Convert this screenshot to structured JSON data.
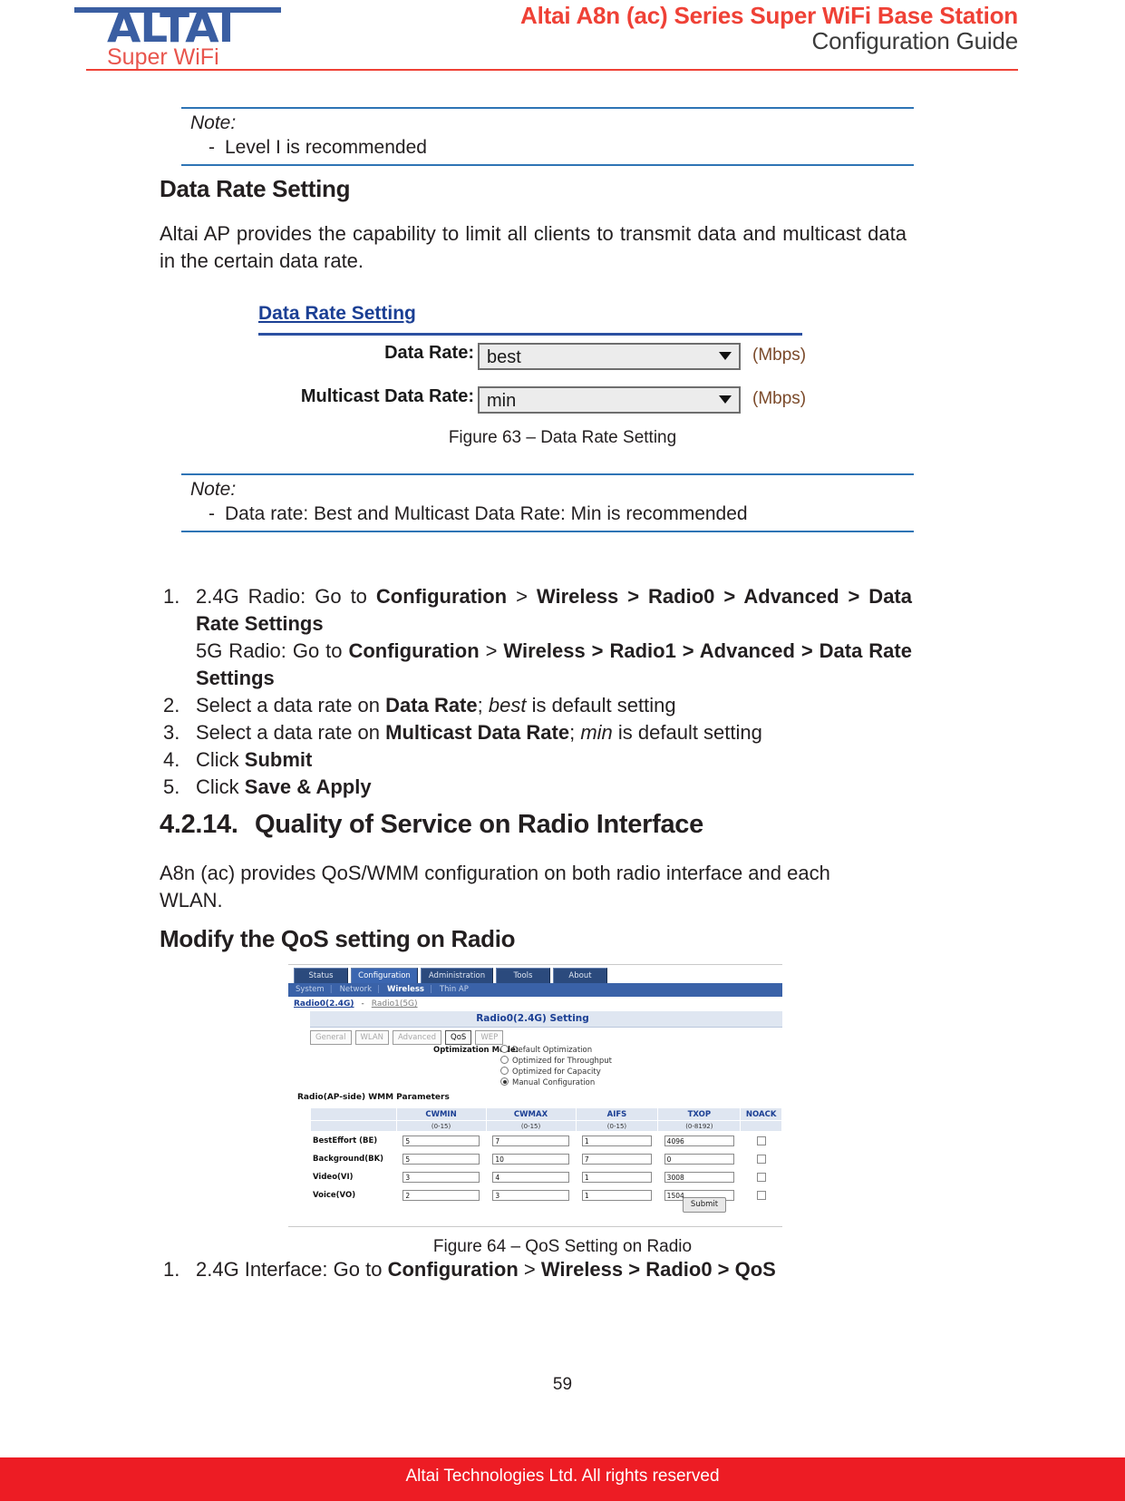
{
  "header": {
    "logo_main": "ALTAI",
    "logo_sub": "Super WiFi",
    "title_line1": "Altai A8n (ac) Series Super WiFi Base Station",
    "title_line2": "Configuration Guide",
    "brand_red": "#ef4136",
    "brand_blue": "#3a5ea2"
  },
  "note1": {
    "title": "Note:",
    "dash": "-",
    "item": "Level I is recommended"
  },
  "heading_data_rate": "Data Rate Setting",
  "para_data_rate": "Altai AP provides the capability to limit all clients to transmit data and multicast data in the certain data rate.",
  "figure63": {
    "panel_title": "Data Rate Setting",
    "rows": [
      {
        "label": "Data Rate:",
        "value": "best",
        "unit": "(Mbps)"
      },
      {
        "label": "Multicast Data Rate:",
        "value": "min",
        "unit": "(Mbps)"
      }
    ],
    "caption": "Figure 63 – Data Rate Setting"
  },
  "note2": {
    "title": "Note:",
    "dash": "-",
    "item": "Data rate: Best and Multicast Data Rate: Min is recommended"
  },
  "steps_data_rate": [
    {
      "n": "1.",
      "lines": [
        {
          "segments": [
            {
              "t": "2.4G Radio: Go to ",
              "style": "normal"
            },
            {
              "t": "Configuration",
              "style": "bold"
            },
            {
              "t": " > ",
              "style": "normal"
            },
            {
              "t": "Wireless > Radio0 > Advanced > Data Rate Settings",
              "style": "bold"
            }
          ]
        },
        {
          "segments": [
            {
              "t": "5G Radio: Go to ",
              "style": "normal"
            },
            {
              "t": "Configuration",
              "style": "bold"
            },
            {
              "t": " > ",
              "style": "normal"
            },
            {
              "t": "Wireless > Radio1 > Advanced > Data Rate Settings",
              "style": "bold"
            }
          ]
        }
      ]
    },
    {
      "n": "2.",
      "lines": [
        {
          "segments": [
            {
              "t": "Select a data rate on ",
              "style": "normal"
            },
            {
              "t": "Data Rate",
              "style": "bold"
            },
            {
              "t": "; ",
              "style": "normal"
            },
            {
              "t": "best",
              "style": "italic"
            },
            {
              "t": " is default setting",
              "style": "normal"
            }
          ]
        }
      ]
    },
    {
      "n": "3.",
      "lines": [
        {
          "segments": [
            {
              "t": "Select a data rate on ",
              "style": "normal"
            },
            {
              "t": "Multicast Data Rate",
              "style": "bold"
            },
            {
              "t": "; ",
              "style": "normal"
            },
            {
              "t": "min",
              "style": "italic"
            },
            {
              "t": " is default setting",
              "style": "normal"
            }
          ]
        }
      ]
    },
    {
      "n": "4.",
      "lines": [
        {
          "segments": [
            {
              "t": "Click ",
              "style": "normal"
            },
            {
              "t": "Submit",
              "style": "bold"
            }
          ]
        }
      ]
    },
    {
      "n": "5.",
      "lines": [
        {
          "segments": [
            {
              "t": "Click ",
              "style": "normal"
            },
            {
              "t": "Save & Apply",
              "style": "bold"
            }
          ]
        }
      ]
    }
  ],
  "section": {
    "number": "4.2.14.",
    "title": "Quality of Service on Radio Interface",
    "para": "A8n (ac) provides QoS/WMM configuration on both radio interface and each WLAN.",
    "sub_heading": "Modify the QoS setting on Radio"
  },
  "figure64": {
    "caption": "Figure 64 – QoS Setting on Radio",
    "nav_tabs": [
      {
        "label": "Status",
        "active": false
      },
      {
        "label": "Configuration",
        "active": true
      },
      {
        "label": "Administration",
        "active": false
      },
      {
        "label": "Tools",
        "active": false
      },
      {
        "label": "About",
        "active": false
      }
    ],
    "sub_nav": [
      {
        "label": "System",
        "active": false
      },
      {
        "label": "Network",
        "active": false
      },
      {
        "label": "Wireless",
        "active": true
      },
      {
        "label": "Thin AP",
        "active": false
      }
    ],
    "radio_links": [
      {
        "label": "Radio0(2.4G)",
        "active": true
      },
      {
        "label": "Radio1(5G)",
        "active": false
      }
    ],
    "radio_link_separator": "-",
    "setting_bar_title": "Radio0(2.4G) Setting",
    "sub_tabs": [
      {
        "label": "General",
        "selected": false
      },
      {
        "label": "WLAN",
        "selected": false
      },
      {
        "label": "Advanced",
        "selected": false
      },
      {
        "label": "QoS",
        "selected": true
      },
      {
        "label": "WEP",
        "selected": false
      }
    ],
    "optimization_label": "Optimization Mode:",
    "optimization_options": [
      {
        "label": "Default Optimization",
        "checked": false
      },
      {
        "label": "Optimized for Throughput",
        "checked": false
      },
      {
        "label": "Optimized for Capacity",
        "checked": false
      },
      {
        "label": "Manual Configuration",
        "checked": true
      }
    ],
    "wmm_title": "Radio(AP-side) WMM Parameters",
    "wmm_headers": [
      {
        "label": "",
        "range": ""
      },
      {
        "label": "CWMIN",
        "range": "(0-15)"
      },
      {
        "label": "CWMAX",
        "range": "(0-15)"
      },
      {
        "label": "AIFS",
        "range": "(0-15)"
      },
      {
        "label": "TXOP",
        "range": "(0-8192)"
      },
      {
        "label": "NOACK",
        "range": ""
      }
    ],
    "wmm_rows": [
      {
        "name": "BestEffort (BE)",
        "cwmin": "5",
        "cwmax": "7",
        "aifs": "1",
        "txop": "4096",
        "noack": false
      },
      {
        "name": "Background(BK)",
        "cwmin": "5",
        "cwmax": "10",
        "aifs": "7",
        "txop": "0",
        "noack": false
      },
      {
        "name": "Video(VI)",
        "cwmin": "3",
        "cwmax": "4",
        "aifs": "1",
        "txop": "3008",
        "noack": false
      },
      {
        "name": "Voice(VO)",
        "cwmin": "2",
        "cwmax": "3",
        "aifs": "1",
        "txop": "1504",
        "noack": false
      }
    ],
    "submit_label": "Submit"
  },
  "steps_qos": [
    {
      "n": "1.",
      "lines": [
        {
          "segments": [
            {
              "t": "2.4G Interface: Go to ",
              "style": "normal"
            },
            {
              "t": "Configuration",
              "style": "bold"
            },
            {
              "t": " > ",
              "style": "normal"
            },
            {
              "t": "Wireless > Radio0 > QoS",
              "style": "bold"
            }
          ]
        }
      ]
    }
  ],
  "footer": {
    "page_number": "59",
    "text": "Altai Technologies Ltd. All rights reserved",
    "bar_color": "#ed1c24"
  }
}
